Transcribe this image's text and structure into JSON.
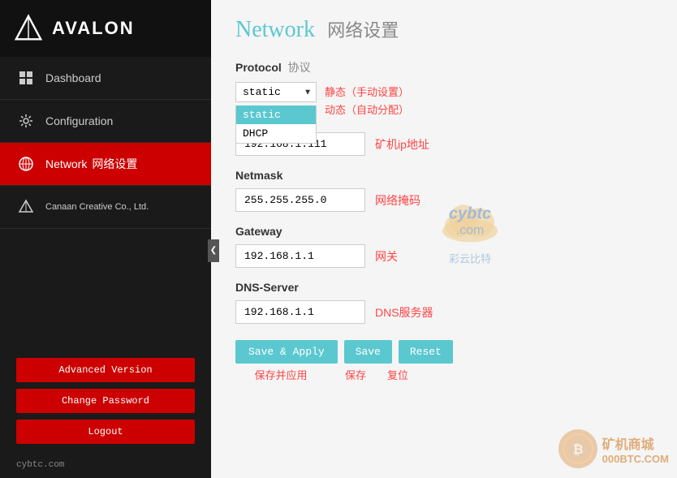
{
  "app": {
    "logo_text": "AVALON",
    "title": "Network",
    "title_cn": "网络设置"
  },
  "sidebar": {
    "nav_items": [
      {
        "id": "dashboard",
        "label_en": "Dashboard",
        "label_cn": "",
        "active": false
      },
      {
        "id": "configuration",
        "label_en": "Configuration",
        "label_cn": "",
        "active": false
      },
      {
        "id": "network",
        "label_en": "Network",
        "label_cn": "网络设置",
        "active": true
      },
      {
        "id": "canaan",
        "label_en": "Canaan Creative Co., Ltd.",
        "label_cn": "",
        "active": false
      }
    ],
    "buttons": [
      {
        "id": "advanced",
        "label": "Advanced Version"
      },
      {
        "id": "change-password",
        "label": "Change Password"
      },
      {
        "id": "logout",
        "label": "Logout"
      }
    ],
    "footer": "cybtc.com"
  },
  "network": {
    "protocol_section": {
      "label_en": "Protocol",
      "label_cn": "协议"
    },
    "protocol_select": {
      "value": "static",
      "options": [
        {
          "value": "static",
          "label": "static",
          "selected": true
        },
        {
          "value": "DHCP",
          "label": "DHCP"
        }
      ]
    },
    "protocol_desc_static": "静态（手动设置）",
    "protocol_desc_dhcp": "动态（自动分配）",
    "ip_section": {
      "value": "192.168.1.111",
      "description": "矿机ip地址"
    },
    "netmask_section": {
      "label_en": "Netmask",
      "value": "255.255.255.0",
      "description": "网络掩码"
    },
    "gateway_section": {
      "label_en": "Gateway",
      "value": "192.168.1.1",
      "description": "网关"
    },
    "dns_section": {
      "label_en": "DNS-Server",
      "value": "192.168.1.1",
      "description": "DNS服务器"
    },
    "buttons": {
      "save_apply": "Save & Apply",
      "save": "Save",
      "reset": "Reset"
    },
    "button_labels_cn": {
      "save_apply": "保存并应用",
      "save": "保存",
      "reset": "复位"
    }
  },
  "watermark": {
    "cybtc": "cybtc",
    "cybtc_dot_com": ".com",
    "cybtc_cn": "彩云比特",
    "bottom_text1": "矿机商城",
    "bottom_url": "000BTC.COM"
  }
}
